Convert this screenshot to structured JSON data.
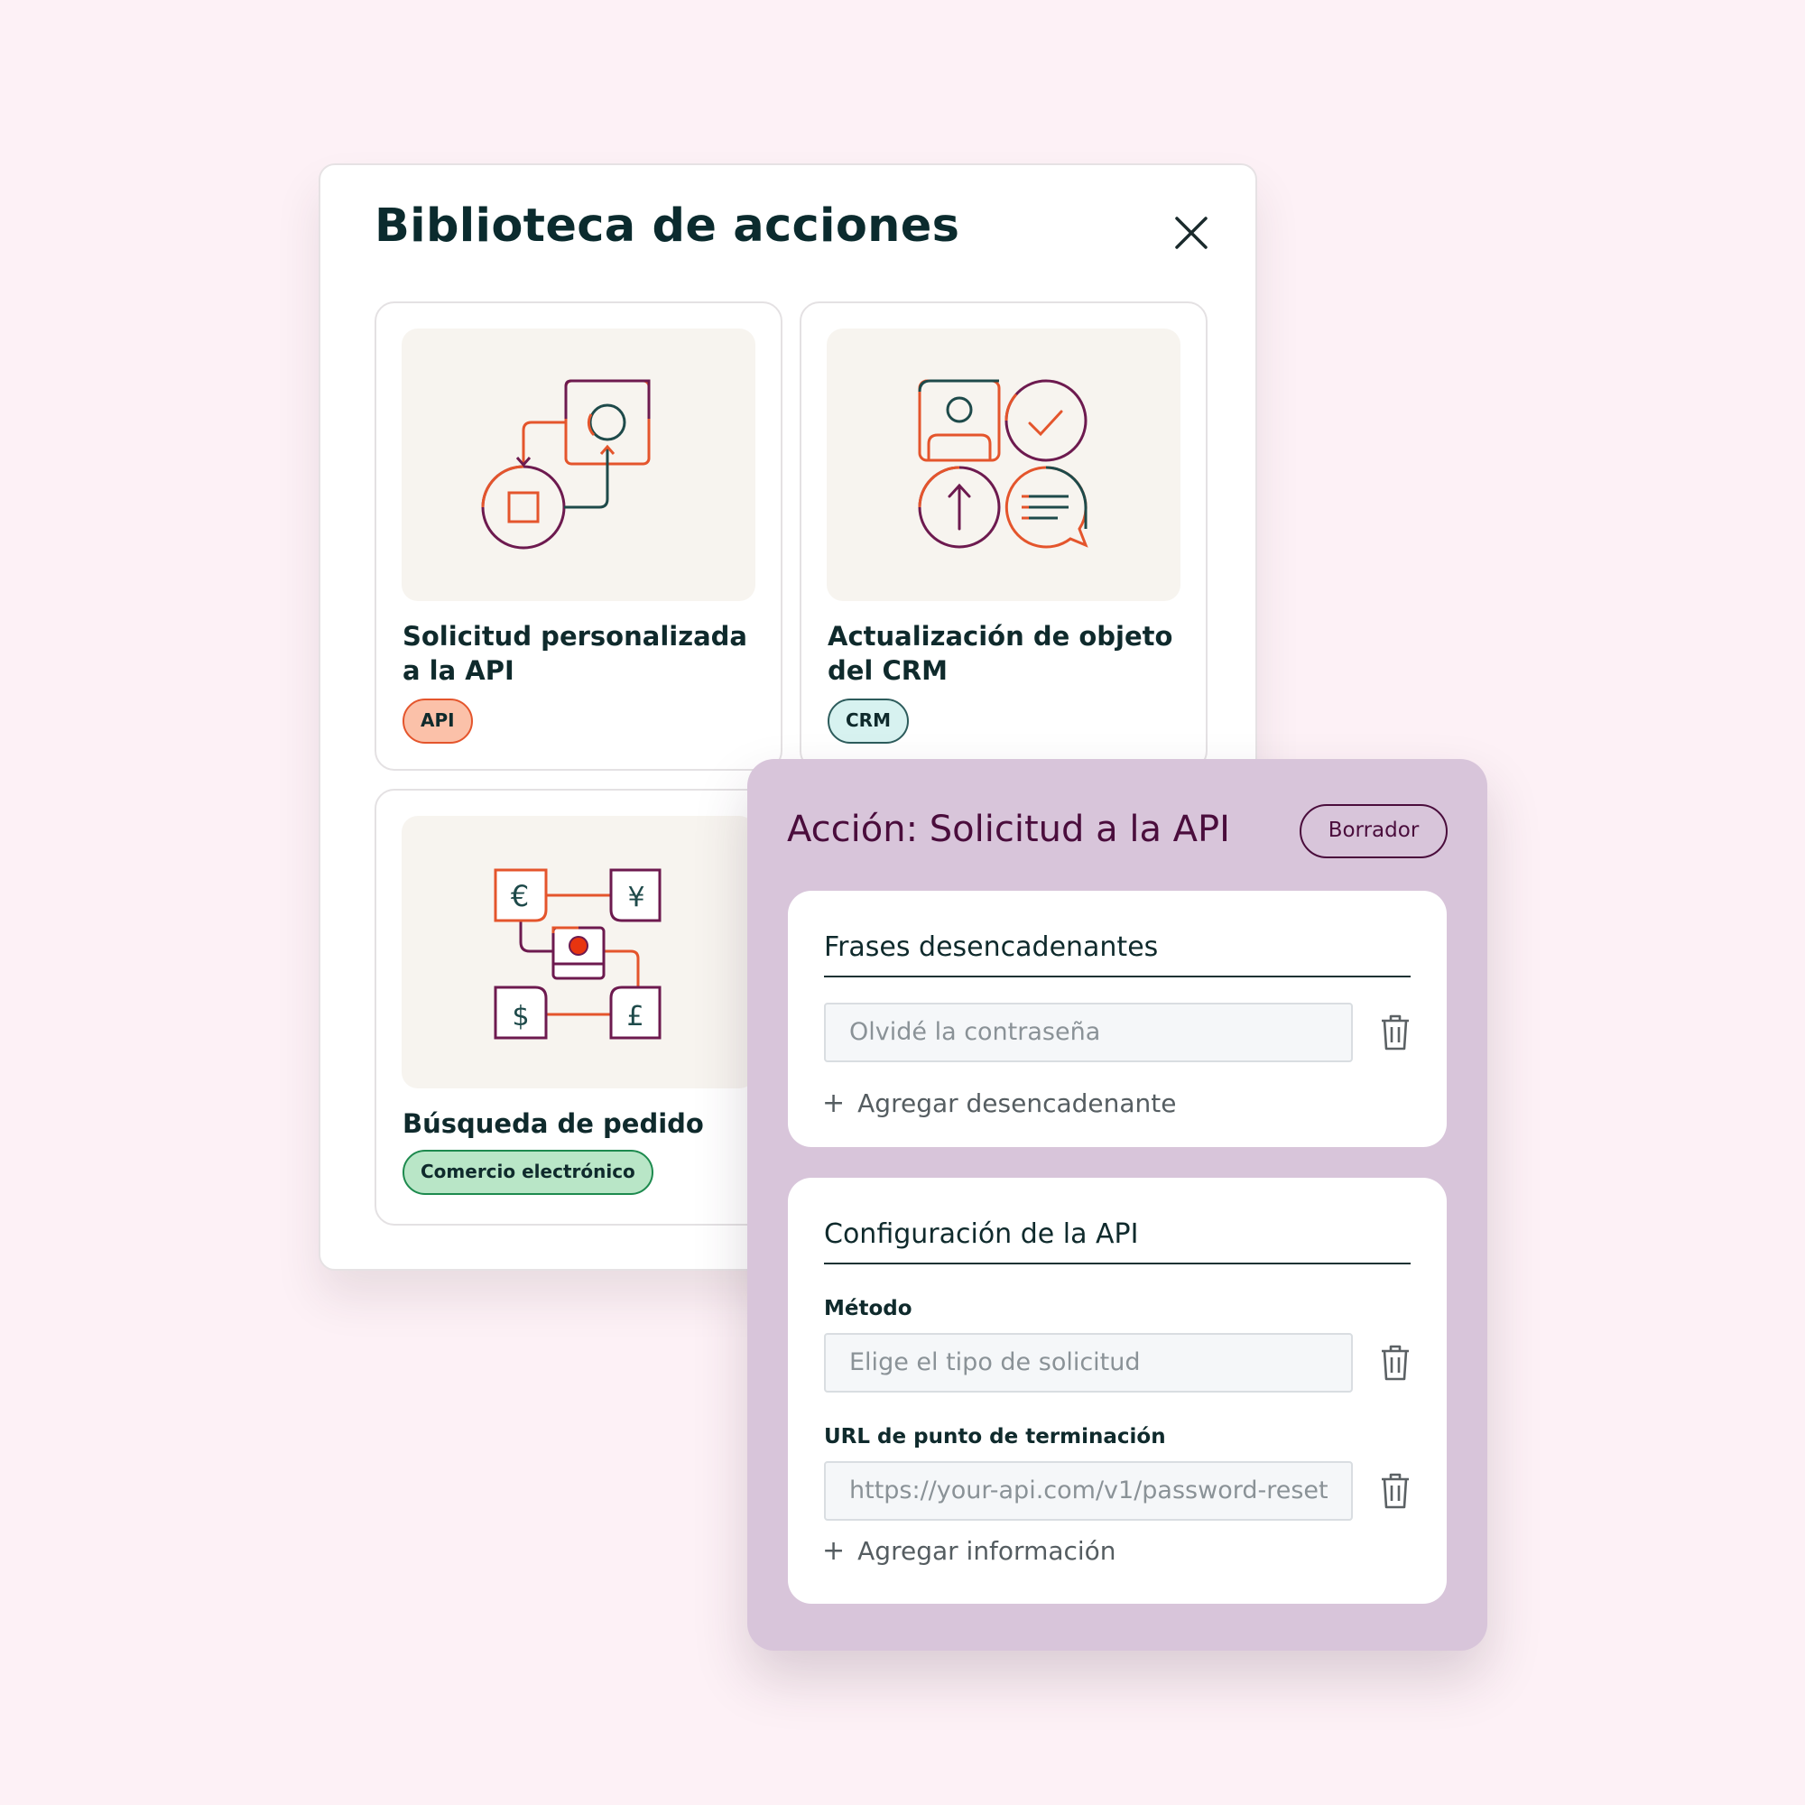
{
  "library": {
    "title": "Biblioteca de acciones",
    "close_icon": "close-icon",
    "cards": [
      {
        "title": "Solicitud personalizada a la API",
        "tag": "API",
        "icon": "api-flow-illustration",
        "tag_color": "#fbc1a9"
      },
      {
        "title": "Actualización de objeto del CRM",
        "tag": "CRM",
        "icon": "crm-update-illustration",
        "tag_color": "#d7f2f0"
      },
      {
        "title": "Búsqueda de pedido",
        "tag": "Comercio electrónico",
        "icon": "currency-exchange-illustration",
        "tag_color": "#b9e6c7"
      }
    ]
  },
  "action": {
    "title": "Acción: Solicitud a la API",
    "status_badge": "Borrador",
    "triggers": {
      "title": "Frases desencadenantes",
      "input_placeholder": "Olvidé la contraseña",
      "add_label": "Agregar desencadenante"
    },
    "api_config": {
      "title": "Configuración de la API",
      "method_label": "Método",
      "method_placeholder": "Elige el tipo de solicitud",
      "url_label": "URL de punto de terminación",
      "url_placeholder": "https://your-api.com/v1/password-reset",
      "add_label": "Agregar información"
    }
  },
  "colors": {
    "background": "#fdf1f6",
    "panel": "#d8c5da",
    "accent_plum": "#4a0d3c",
    "accent_orange": "#e4552c",
    "text_dark": "#0f2a2c"
  }
}
